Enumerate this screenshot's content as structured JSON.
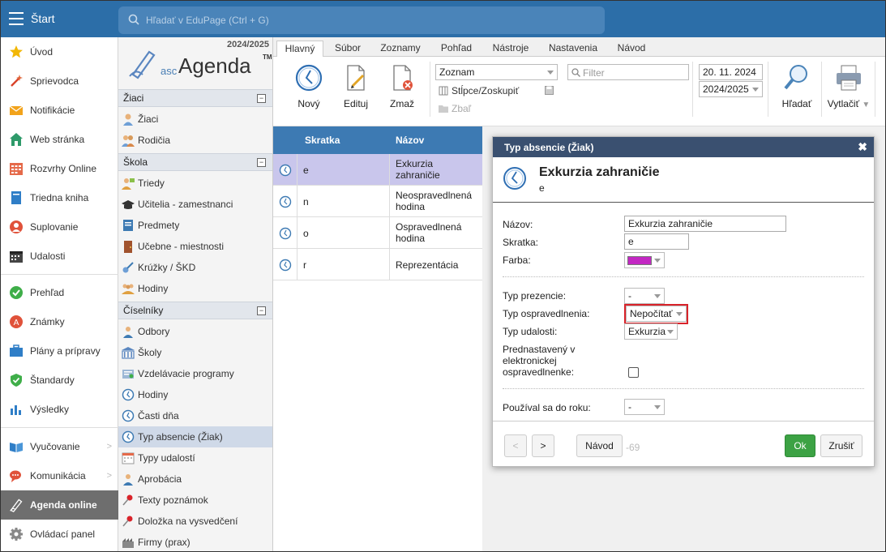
{
  "topbar": {
    "start_label": "Štart",
    "search_placeholder": "Hľadať v EduPage (Ctrl + G)"
  },
  "leftnav": {
    "items": [
      {
        "label": "Úvod",
        "icon": "star-icon"
      },
      {
        "label": "Sprievodca",
        "icon": "wand-icon"
      },
      {
        "label": "Notifikácie",
        "icon": "envelope-icon"
      },
      {
        "label": "Web stránka",
        "icon": "house-icon"
      },
      {
        "label": "Rozvrhy Online",
        "icon": "timetable-icon"
      },
      {
        "label": "Triedna kniha",
        "icon": "book-icon"
      },
      {
        "label": "Suplovanie",
        "icon": "person-icon"
      },
      {
        "label": "Udalosti",
        "icon": "calendar-icon"
      },
      {
        "label": "Prehľad",
        "icon": "check-circle-icon"
      },
      {
        "label": "Známky",
        "icon": "grade-icon"
      },
      {
        "label": "Plány a prípravy",
        "icon": "briefcase-icon"
      },
      {
        "label": "Štandardy",
        "icon": "shield-check-icon"
      },
      {
        "label": "Výsledky",
        "icon": "bar-chart-icon"
      },
      {
        "label": "Vyučovanie",
        "icon": "open-book-icon"
      },
      {
        "label": "Komunikácia",
        "icon": "chat-icon"
      },
      {
        "label": "Agenda online",
        "icon": "agenda-icon"
      },
      {
        "label": "Ovládací panel",
        "icon": "gear-icon"
      }
    ]
  },
  "col2": {
    "year": "2024/2025",
    "logo_asc": "asc",
    "logo_agenda": "Agenda",
    "logo_tm": "TM",
    "sections": [
      {
        "title": "Žiaci",
        "items": [
          "Žiaci",
          "Rodičia"
        ]
      },
      {
        "title": "Škola",
        "items": [
          "Triedy",
          "Učitelia - zamestnanci",
          "Predmety",
          "Učebne - miestnosti",
          "Krúžky / ŠKD",
          "Hodiny"
        ]
      },
      {
        "title": "Číselníky",
        "items": [
          "Odbory",
          "Školy",
          "Vzdelávacie programy",
          "Hodiny",
          "Časti dňa",
          "Typ absencie (Žiak)",
          "Typy udalostí",
          "Aprobácia",
          "Texty poznámok",
          "Doložka na vysvedčení",
          "Firmy (prax)"
        ]
      }
    ],
    "collapse_symbol": "−"
  },
  "tabs": [
    "Hlavný",
    "Súbor",
    "Zoznamy",
    "Pohľad",
    "Nástroje",
    "Nastavenia",
    "Návod"
  ],
  "ribbon": {
    "new_label": "Nový",
    "edit_label": "Edituj",
    "delete_label": "Zmaž",
    "view_select": "Zoznam",
    "columns_group": "Stĺpce/Zoskupiť",
    "collapse": "Zbaľ",
    "filter_placeholder": "Filter",
    "date": "20. 11. 2024",
    "year_select": "2024/2025",
    "search_label": "Hľadať",
    "print_label": "Vytlačiť"
  },
  "table": {
    "headers": [
      "Skratka",
      "Názov"
    ],
    "rows": [
      {
        "skratka": "e",
        "nazov": "Exkurzia zahraničie"
      },
      {
        "skratka": "n",
        "nazov": "Neospravedlnená hodina"
      },
      {
        "skratka": "o",
        "nazov": "Ospravedlnená hodina"
      },
      {
        "skratka": "r",
        "nazov": "Reprezentácia"
      }
    ]
  },
  "dialog": {
    "title": "Typ absencie (Žiak)",
    "close": "✖",
    "head_title": "Exkurzia zahraničie",
    "head_sub": "e",
    "fields": {
      "nazov_label": "Názov:",
      "nazov_value": "Exkurzia zahraničie",
      "skratka_label": "Skratka:",
      "skratka_value": "e",
      "farba_label": "Farba:",
      "farba_color": "#c327c3",
      "typ_prezencie_label": "Typ prezencie:",
      "typ_prezencie_value": "-",
      "typ_ospravedlnenia_label": "Typ ospravedlnenia:",
      "typ_ospravedlnenia_value": "Nepočítať",
      "typ_udalosti_label": "Typ udalosti:",
      "typ_udalosti_value": "Exkurzia",
      "prednastaveny_label_1": "Prednastavený v",
      "prednastaveny_label_2": "elektronickej",
      "prednastaveny_label_3": "ospravedlnenke:",
      "pouzival_label": "Používal sa do roku:",
      "pouzival_value": "-"
    },
    "buttons": {
      "prev": "<",
      "next": ">",
      "help": "Návod",
      "counter": "-69",
      "ok": "Ok",
      "cancel": "Zrušiť"
    }
  },
  "colors": {
    "topbar": "#2c6ea8",
    "table_header": "#3d7ab3",
    "dialog_title": "#3a5070",
    "highlight": "#d9232a",
    "ok": "#3ca244"
  }
}
